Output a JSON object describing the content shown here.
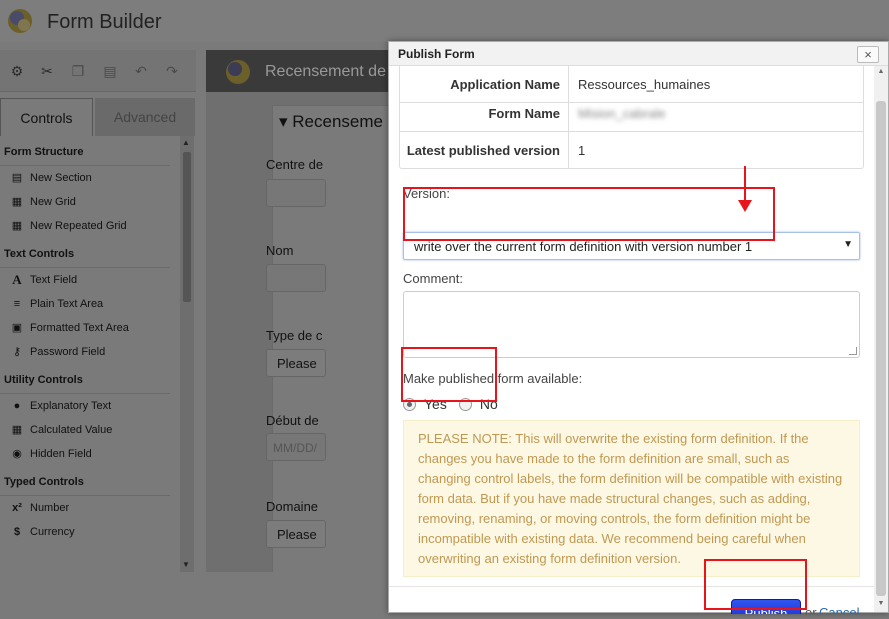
{
  "app": {
    "title": "Form Builder"
  },
  "toolbar": {
    "icons": [
      "gears-icon",
      "cut-icon",
      "copy-icon",
      "paste-icon",
      "undo-icon",
      "redo-icon"
    ]
  },
  "tabs": {
    "controls": "Controls",
    "advanced": "Advanced"
  },
  "palette": {
    "groups": [
      {
        "title": "Form Structure",
        "items": [
          "New Section",
          "New Grid",
          "New Repeated Grid"
        ]
      },
      {
        "title": "Text Controls",
        "items": [
          "Text Field",
          "Plain Text Area",
          "Formatted Text Area",
          "Password Field"
        ]
      },
      {
        "title": "Utility Controls",
        "items": [
          "Explanatory Text",
          "Calculated Value",
          "Hidden Field"
        ]
      },
      {
        "title": "Typed Controls",
        "items": [
          "Number",
          "Currency"
        ]
      }
    ]
  },
  "form_bg": {
    "title": "Recensement de",
    "section_title": "Recenseme",
    "fields": [
      {
        "label": "Centre de",
        "kind": "input"
      },
      {
        "label": "Nom",
        "kind": "input"
      },
      {
        "label": "Type de c",
        "kind": "select",
        "value": "Please"
      },
      {
        "label": "Début de",
        "kind": "input",
        "placeholder": "MM/DD/"
      },
      {
        "label": "Domaine",
        "kind": "select",
        "value": "Please"
      }
    ]
  },
  "modal": {
    "title": "Publish Form",
    "close": "×",
    "info": [
      {
        "key": "Application Name",
        "value": "Ressources_humaines"
      },
      {
        "key": "Form Name",
        "value": "Mision_cabrale"
      },
      {
        "key": "Latest published version",
        "value": "1"
      }
    ],
    "version_label": "Version:",
    "version_value": "write over the current form definition with version number 1",
    "comment_label": "Comment:",
    "available_label": "Make published form available:",
    "radio_yes": "Yes",
    "radio_no": "No",
    "available_selected": "Yes",
    "note": "PLEASE NOTE: This will overwrite the existing form definition. If the changes you have made to the form definition are small, such as changing control labels, the form definition will be compatible with existing form data. But if you have made structural changes, such as adding, removing, renaming, or moving controls, the form definition might be incompatible with existing data. We recommend being careful when overwriting an existing form definition version.",
    "publish": "Publish",
    "or": "or",
    "cancel": "Cancel"
  },
  "colors": {
    "annotation": "#e8141c",
    "publish_button": "#2233dd",
    "note_bg": "#fcf8e3",
    "note_text": "#c09853"
  }
}
